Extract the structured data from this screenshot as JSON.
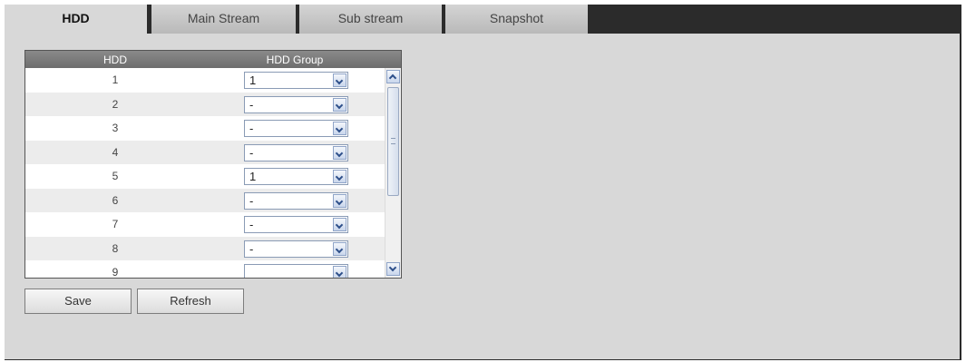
{
  "tabs": [
    {
      "label": "HDD",
      "active": true
    },
    {
      "label": "Main Stream",
      "active": false
    },
    {
      "label": "Sub stream",
      "active": false
    },
    {
      "label": "Snapshot",
      "active": false
    }
  ],
  "table": {
    "headers": [
      "HDD",
      "HDD Group"
    ],
    "rows": [
      {
        "hdd": "1",
        "group": "1"
      },
      {
        "hdd": "2",
        "group": "-"
      },
      {
        "hdd": "3",
        "group": "-"
      },
      {
        "hdd": "4",
        "group": "-"
      },
      {
        "hdd": "5",
        "group": "1"
      },
      {
        "hdd": "6",
        "group": "-"
      },
      {
        "hdd": "7",
        "group": "-"
      },
      {
        "hdd": "8",
        "group": "-"
      },
      {
        "hdd": "9",
        "group": ""
      }
    ]
  },
  "buttons": {
    "save": "Save",
    "refresh": "Refresh"
  },
  "icons": {
    "dropdown": "chevron-down-icon",
    "scroll_up": "chevron-up-icon",
    "scroll_down": "chevron-down-icon"
  },
  "colors": {
    "tabbar": "#2b2b2b",
    "panel": "#d8d8d8",
    "header": "#7a7a7a"
  }
}
